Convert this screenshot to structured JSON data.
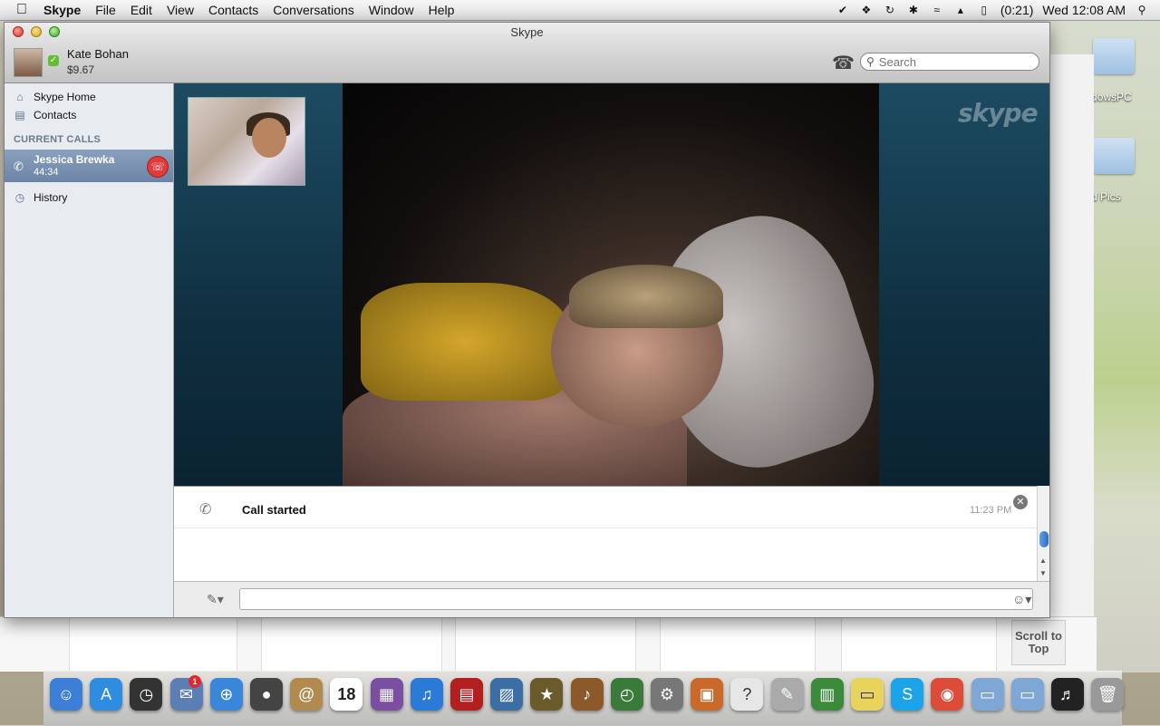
{
  "menubar": {
    "app": "Skype",
    "items": [
      "File",
      "Edit",
      "View",
      "Contacts",
      "Conversations",
      "Window",
      "Help"
    ],
    "battery": "(0:21)",
    "clock": "Wed 12:08 AM"
  },
  "window": {
    "title": "Skype"
  },
  "account": {
    "name": "Kate Bohan",
    "credit": "$9.67"
  },
  "search": {
    "placeholder": "Search"
  },
  "sidebar": {
    "items": [
      {
        "label": "Skype Home",
        "icon": "home-icon"
      },
      {
        "label": "Contacts",
        "icon": "contacts-icon"
      }
    ],
    "current_calls_heading": "CURRENT CALLS",
    "call": {
      "name": "Jessica Brewka",
      "duration": "44:34"
    },
    "history_label": "History"
  },
  "video": {
    "logo": "skype"
  },
  "chat": {
    "event": "Call started",
    "time": "11:23 PM"
  },
  "desktop": {
    "labels": [
      "dowsPC",
      "d Pics"
    ],
    "scroll_to_top": "Scroll to Top"
  },
  "dock": {
    "apps": [
      "Finder",
      "App Store",
      "Dashboard",
      "Mail",
      "Safari",
      "FaceTime",
      "Address Book",
      "iCal",
      "Photo Booth",
      "iTunes",
      "Front Row",
      "iPhoto",
      "iMovie",
      "GarageBand",
      "Time Machine",
      "System Preferences",
      "Keynote",
      "Help",
      "Script Editor",
      "Numbers",
      "Stickies",
      "Skype",
      "Chrome",
      "Applications",
      "Documents",
      "Music",
      "Trash"
    ],
    "calendar_day": "18",
    "mail_badge": "1"
  },
  "colors": {
    "accent": "#6c84a7",
    "hangup": "#e03a3a",
    "status_online": "#5fc12b"
  }
}
